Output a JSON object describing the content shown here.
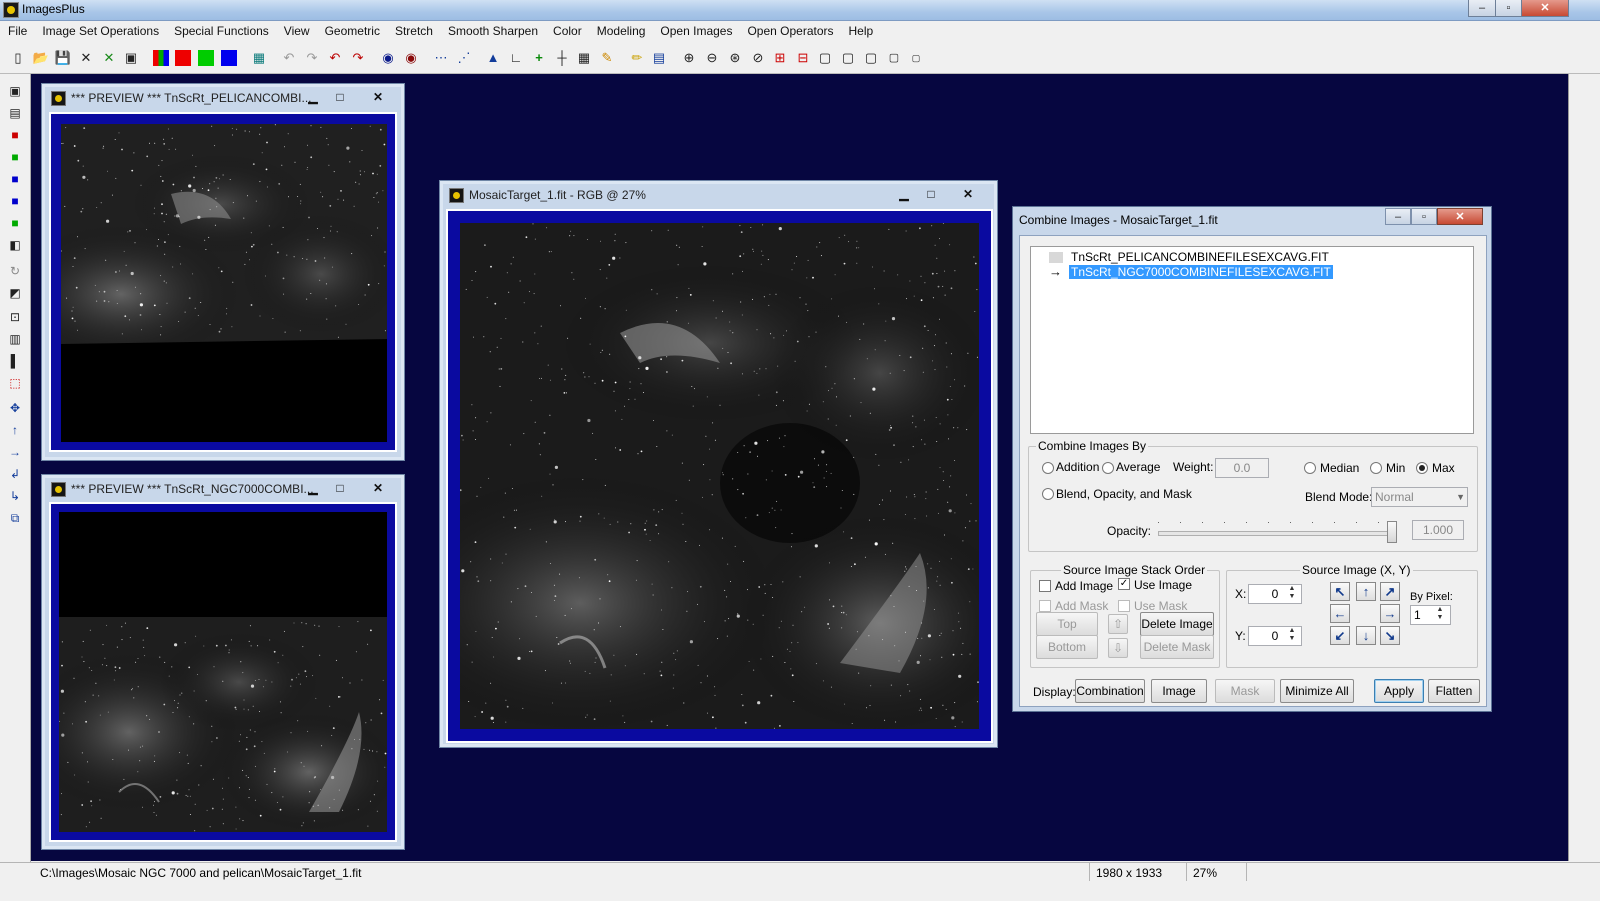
{
  "app": {
    "title": "ImagesPlus",
    "title_suffix": "..."
  },
  "menu": [
    "File",
    "Image Set Operations",
    "Special Functions",
    "View",
    "Geometric",
    "Stretch",
    "Smooth Sharpen",
    "Color",
    "Modeling",
    "Open Images",
    "Open Operators",
    "Help"
  ],
  "windows": {
    "preview1": {
      "title": "*** PREVIEW *** TnScRt_PELICANCOMBI..."
    },
    "preview2": {
      "title": "*** PREVIEW *** TnScRt_NGC7000COMBI..."
    },
    "mosaic": {
      "title": "MosaicTarget_1.fit - RGB @ 27%"
    }
  },
  "dialog": {
    "title": "Combine Images - MosaicTarget_1.fit",
    "list": {
      "item1": "TnScRt_PELICANCOMBINEFILESEXCAVG.FIT",
      "item2": "TnScRt_NGC7000COMBINEFILESEXCAVG.FIT"
    },
    "combine_by": {
      "group_label": "Combine Images By",
      "addition": "Addition",
      "average": "Average",
      "weight_label": "Weight:",
      "weight_value": "0.0",
      "median": "Median",
      "min": "Min",
      "max": "Max",
      "blend": "Blend, Opacity, and Mask",
      "blend_mode_label": "Blend Mode:",
      "blend_mode_value": "Normal",
      "opacity_label": "Opacity:",
      "opacity_value": "1.000",
      "selected": "Max"
    },
    "stack": {
      "group_label": "Source Image Stack Order",
      "add_image": "Add Image",
      "use_image": "Use Image",
      "add_mask": "Add Mask",
      "use_mask": "Use Mask",
      "top": "Top",
      "bottom": "Bottom",
      "delete_image": "Delete Image",
      "delete_mask": "Delete Mask"
    },
    "source": {
      "group_label": "Source Image (X, Y)",
      "x_label": "X:",
      "x_value": "0",
      "y_label": "Y:",
      "y_value": "0",
      "by_pixel_label": "By Pixel:",
      "by_pixel_value": "1"
    },
    "display": {
      "label": "Display:",
      "combination": "Combination",
      "image": "Image",
      "mask": "Mask",
      "minimize_all": "Minimize All",
      "apply": "Apply",
      "flatten": "Flatten"
    }
  },
  "status": {
    "path": "C:\\Images\\Mosaic NGC 7000 and pelican\\MosaicTarget_1.fit",
    "dimensions": "1980 x 1933",
    "zoom": "27%"
  },
  "colors": {
    "mdi_background": "#060640",
    "frame_blue": "#0a0aa0",
    "selection": "#3399ff"
  }
}
